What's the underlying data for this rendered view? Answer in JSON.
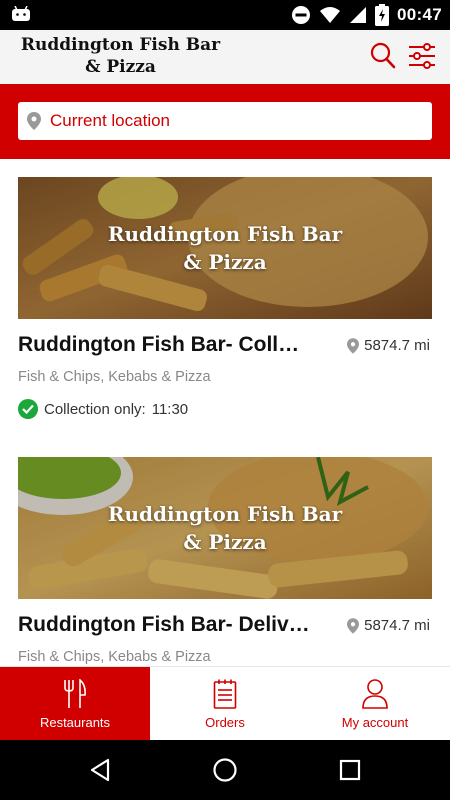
{
  "status_bar": {
    "time": "00:47"
  },
  "header": {
    "title_line1": "Ruddington Fish Bar",
    "title_line2": "& Pizza"
  },
  "search_bar": {
    "placeholder": "Current location"
  },
  "restaurants": [
    {
      "brand_line1": "Ruddington Fish Bar",
      "brand_line2": "& Pizza",
      "name": "Ruddington Fish Bar- Collection",
      "distance": "5874.7 mi",
      "cuisine": "Fish & Chips, Kebabs & Pizza",
      "status_label": "Collection only:",
      "status_time": "11:30"
    },
    {
      "brand_line1": "Ruddington Fish Bar",
      "brand_line2": "& Pizza",
      "name": "Ruddington Fish Bar- Delivery",
      "distance": "5874.7 mi",
      "cuisine": "Fish & Chips, Kebabs & Pizza"
    }
  ],
  "bottom_nav": [
    {
      "label": "Restaurants",
      "icon": "fork-knife-icon",
      "active": true
    },
    {
      "label": "Orders",
      "icon": "receipt-icon",
      "active": false
    },
    {
      "label": "My account",
      "icon": "user-icon",
      "active": false
    }
  ],
  "colors": {
    "accent": "#d10000",
    "success": "#1aa83a",
    "header_bg": "#f4f4f4"
  }
}
